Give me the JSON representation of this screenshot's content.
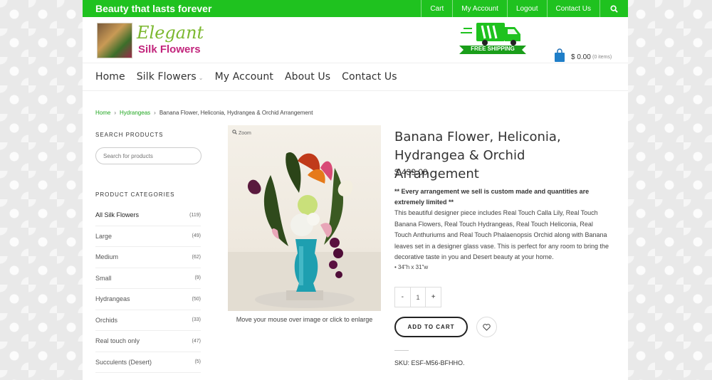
{
  "topbar": {
    "tagline": "Beauty that lasts forever",
    "links": [
      "Cart",
      "My Account",
      "Logout",
      "Contact Us"
    ]
  },
  "header": {
    "logo_line1": "Elegant",
    "logo_line2": "Silk Flowers",
    "shipping_badge": "FREE SHIPPING",
    "cart_amount": "$ 0.00",
    "cart_items": "(0 items)"
  },
  "mainnav": {
    "items": [
      "Home",
      "Silk Flowers",
      "My Account",
      "About Us",
      "Contact Us"
    ]
  },
  "breadcrumb": {
    "home": "Home",
    "category": "Hydrangeas",
    "current": "Banana Flower, Heliconia, Hydrangea & Orchid Arrangement"
  },
  "sidebar": {
    "search_heading": "SEARCH PRODUCTS",
    "search_placeholder": "Search for products",
    "categories_heading": "PRODUCT CATEGORIES",
    "categories": [
      {
        "label": "All Silk Flowers",
        "count": "(119)"
      },
      {
        "label": "Large",
        "count": "(49)"
      },
      {
        "label": "Medium",
        "count": "(62)"
      },
      {
        "label": "Small",
        "count": "(9)"
      },
      {
        "label": "Hydrangeas",
        "count": "(50)"
      },
      {
        "label": "Orchids",
        "count": "(33)"
      },
      {
        "label": "Real touch only",
        "count": "(47)"
      },
      {
        "label": "Succulents (Desert)",
        "count": "(5)"
      }
    ]
  },
  "product": {
    "zoom_label": "Zoom",
    "image_caption": "Move your mouse over image or click to enlarge",
    "title": "Banana Flower, Heliconia, Hydrangea & Orchid Arrangement",
    "price": "$ 439.00",
    "note": "** Every arrangement we sell is custom made and quantities are extremely limited **",
    "description": "This beautiful designer piece includes Real Touch Calla Lily, Real Touch Banana Flowers, Real Touch Hydrangeas, Real Touch Heliconia, Real Touch Anthuriums and Real Touch Phalaenopsis Orchid along with Banana leaves set in a designer glass vase. This is perfect for any room to bring the decorative taste in you and Desert beauty at your home.",
    "size_bullet": "• 34\"h x 31\"w",
    "qty_minus": "-",
    "qty_value": "1",
    "qty_plus": "+",
    "add_to_cart": "ADD TO CART",
    "sku": "SKU: ESF-M56-BFHHO."
  },
  "colors": {
    "accent": "#1fc21f",
    "logo_green": "#7cb82f",
    "logo_pink": "#c2257c",
    "vase": "#1e9fb0"
  }
}
